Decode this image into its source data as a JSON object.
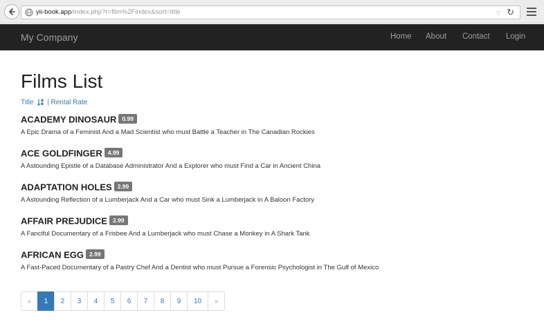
{
  "browser": {
    "url_host": "yii-book.app",
    "url_path": "/index.php?r=film%2Findex&sort=title"
  },
  "navbar": {
    "brand": "My Company",
    "items": [
      {
        "label": "Home"
      },
      {
        "label": "About"
      },
      {
        "label": "Contact"
      },
      {
        "label": "Login"
      }
    ]
  },
  "page": {
    "title": "Films List",
    "sort": {
      "title_label": "Title",
      "separator": "|",
      "rental_rate_label": "Rental Rate"
    }
  },
  "films": [
    {
      "title": "ACADEMY DINOSAUR",
      "rental_rate": "0.99",
      "description": "A Epic Drama of a Feminist And a Mad Scientist who must Battle a Teacher in The Canadian Rockies"
    },
    {
      "title": "ACE GOLDFINGER",
      "rental_rate": "4.99",
      "description": "A Astounding Epistle of a Database Administrator And a Explorer who must Find a Car in Ancient China"
    },
    {
      "title": "ADAPTATION HOLES",
      "rental_rate": "2.99",
      "description": "A Astounding Reflection of a Lumberjack And a Car who must Sink a Lumberjack in A Baloon Factory"
    },
    {
      "title": "AFFAIR PREJUDICE",
      "rental_rate": "2.99",
      "description": "A Fanciful Documentary of a Frisbee And a Lumberjack who must Chase a Monkey in A Shark Tank"
    },
    {
      "title": "AFRICAN EGG",
      "rental_rate": "2.99",
      "description": "A Fast-Paced Documentary of a Pastry Chef And a Dentist who must Pursue a Forensic Psychologist in The Gulf of Mexico"
    }
  ],
  "pagination": {
    "prev": "«",
    "next": "»",
    "pages": [
      "1",
      "2",
      "3",
      "4",
      "5",
      "6",
      "7",
      "8",
      "9",
      "10"
    ],
    "active_page": "1"
  },
  "colors": {
    "navbar_bg": "#222222",
    "link": "#337ab7",
    "badge": "#777777"
  },
  "icons": {
    "back": "back-arrow-icon",
    "site": "globe-icon",
    "reload": "reload-icon",
    "menu": "hamburger-menu-icon",
    "sort": "sort-alpha-icon"
  }
}
